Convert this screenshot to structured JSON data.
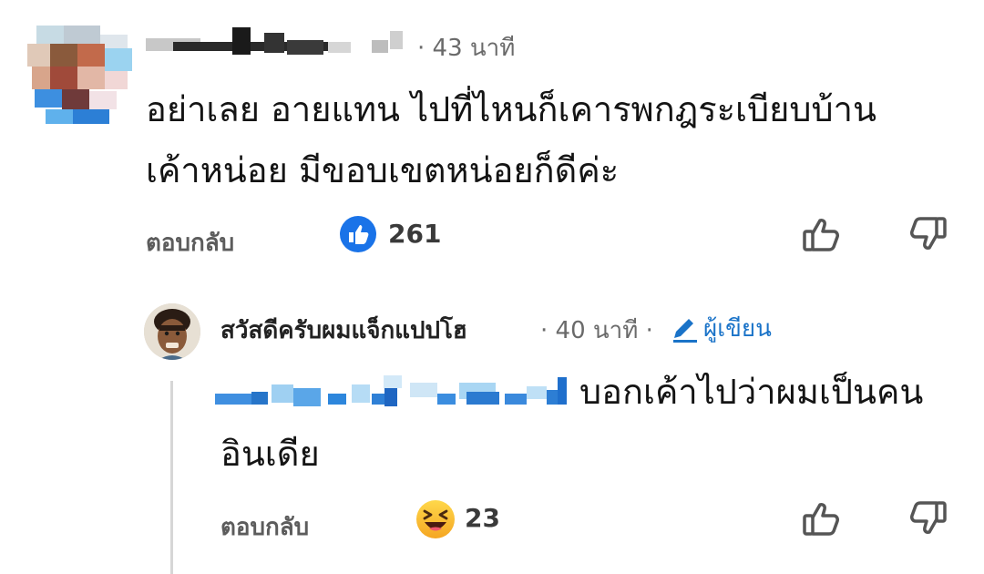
{
  "comment1": {
    "time": "· 43 นาที",
    "text_line1": "อย่าเลย อายแทน ไปที่ไหนก็เคารพกฎระเบียบบ้าน",
    "text_line2": "เค้าหน่อย มีขอบเขตหน่อยก็ดีค่ะ",
    "reply_label": "ตอบกลับ",
    "reaction_icon": "like-reaction-icon",
    "reaction_count": "261"
  },
  "comment2": {
    "author": "สวัสดีครับผมแจ็กแปปโฮ",
    "time": "· 40 นาที ·",
    "author_badge": "ผู้เขียน",
    "text_line1": "บอกเค้าไปว่าผมเป็นคน",
    "text_line2": "อินเดีย",
    "reply_label": "ตอบกลับ",
    "reaction_icon": "laugh-reaction-icon",
    "reaction_count": "23"
  },
  "colors": {
    "accent_blue": "#1a73c8",
    "thread_line": "#d6d6d6"
  }
}
